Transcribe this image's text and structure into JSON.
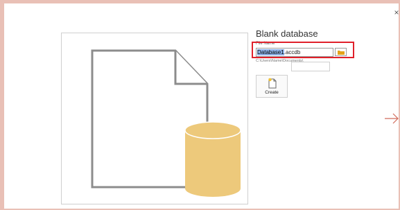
{
  "dialog": {
    "close_glyph": "×",
    "title": "Blank database",
    "file_name_label": "File Name",
    "file_name_selected": "Database1",
    "file_name_rest": ".accdb",
    "path": "C:\\Users\\Name\\Documents\\",
    "create_label": "Create"
  },
  "colors": {
    "highlight_border": "#e0202a",
    "selection": "#8fb4ea",
    "database_fill": "#edc97b",
    "folder_icon": "#e3a21a"
  },
  "icons": {
    "close": "close-icon",
    "browse": "folder-icon",
    "create": "new-document-icon",
    "next": "arrow-right-icon",
    "preview": "blank-database-illustration"
  }
}
